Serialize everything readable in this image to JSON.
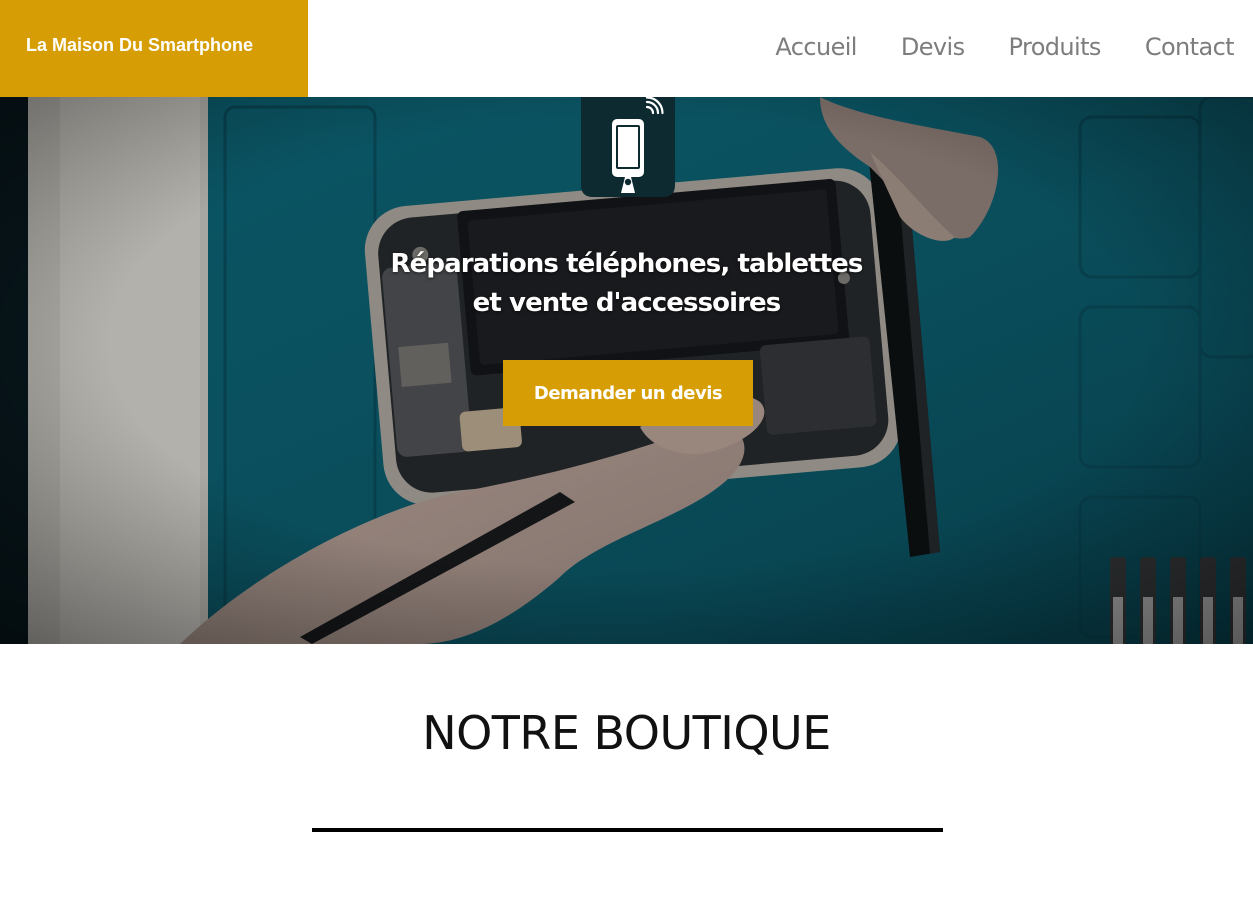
{
  "header": {
    "brand": "La Maison Du Smartphone",
    "nav": [
      "Accueil",
      "Devis",
      "Produits",
      "Contact"
    ]
  },
  "hero": {
    "title_line1": "Réparations téléphones, tablettes",
    "title_line2": "et vente d'accessoires",
    "cta_label": "Demander un devis",
    "logo_icon": "smartphone-wifi-icon"
  },
  "section": {
    "title": "NOTRE BOUTIQUE"
  },
  "colors": {
    "brand": "#d69e04",
    "nav_text": "#7d7d7d",
    "hero_teal": "#0b5b6c"
  }
}
